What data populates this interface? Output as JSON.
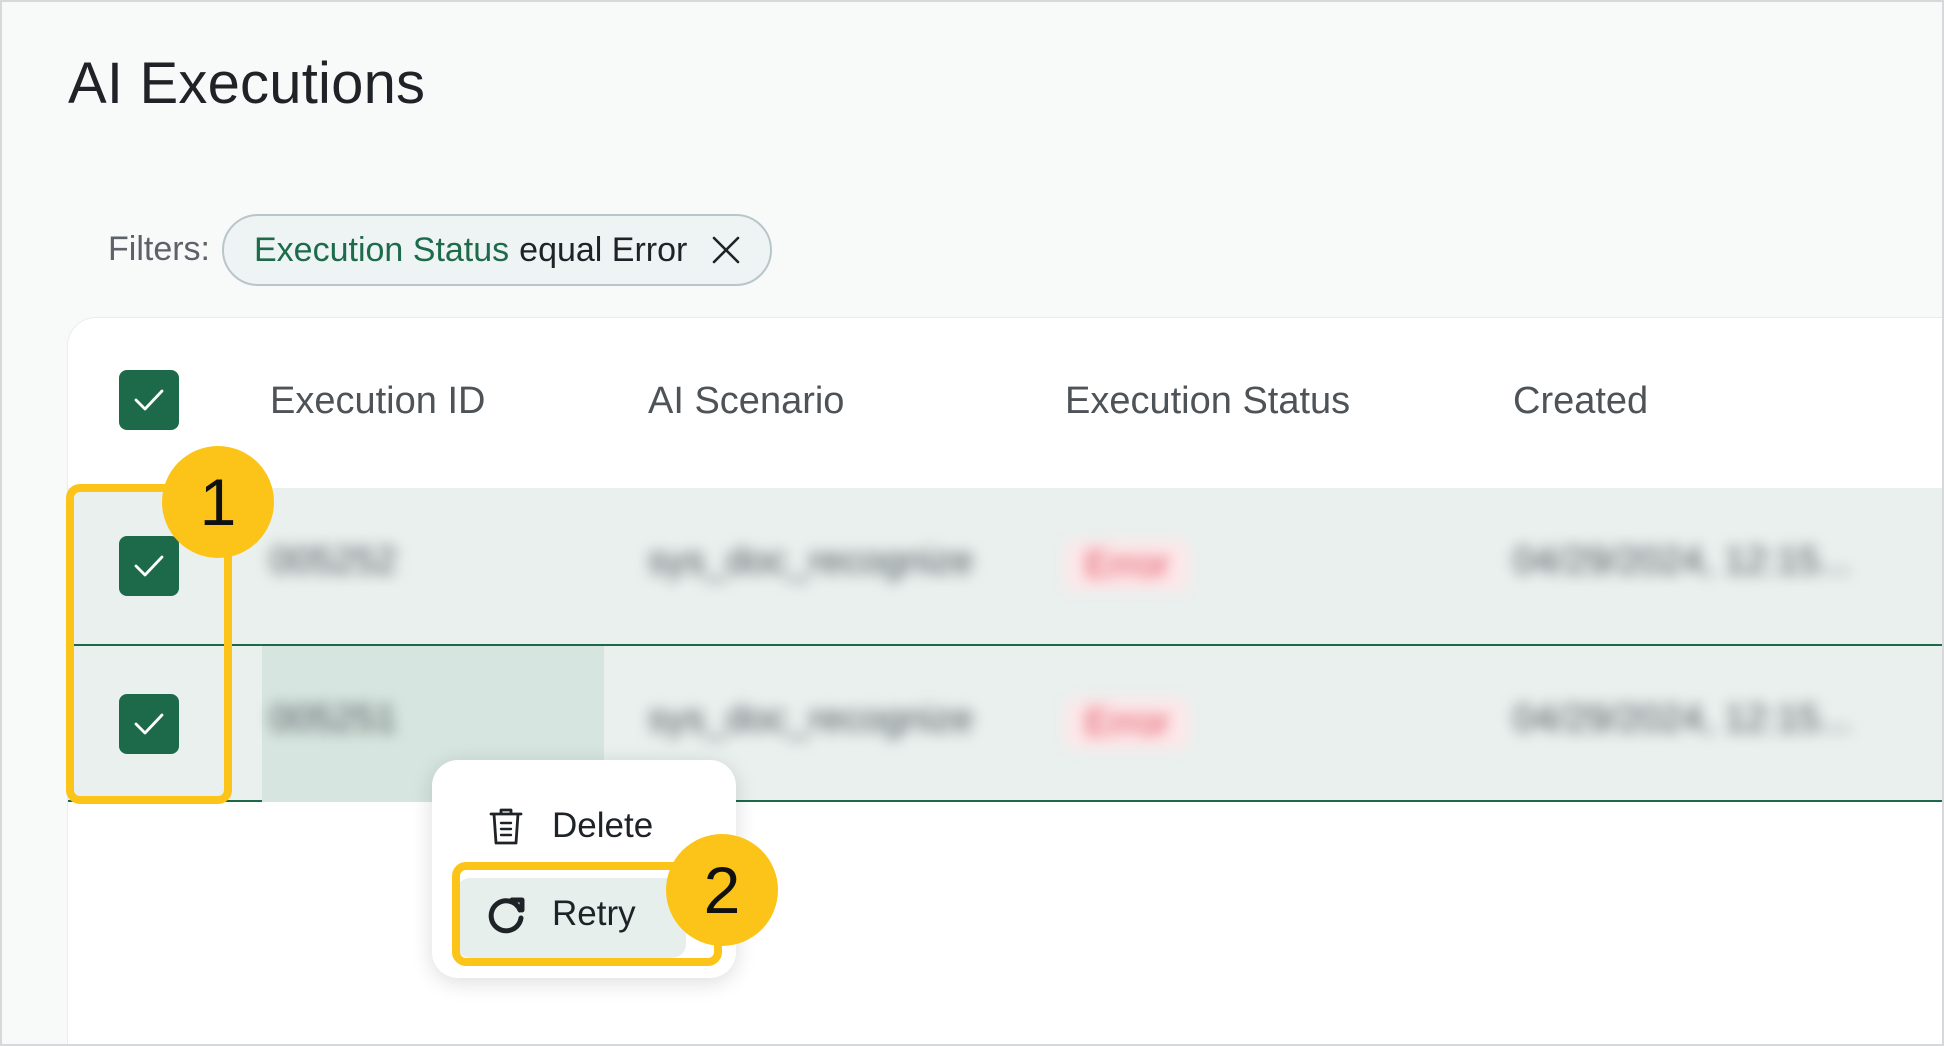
{
  "page": {
    "title": "AI Executions"
  },
  "filters": {
    "label": "Filters:",
    "chip": {
      "field": "Execution Status",
      "rest": "equal Error"
    }
  },
  "table": {
    "columns": [
      "Execution ID",
      "AI Scenario",
      "Execution Status",
      "Created"
    ],
    "rows": [
      {
        "id": "005252",
        "scenario": "sys_doc_recognize",
        "status": "Error",
        "created": "04/29/2024, 12:15..."
      },
      {
        "id": "005251",
        "scenario": "sys_doc_recognize",
        "status": "Error",
        "created": "04/29/2024, 12:15..."
      }
    ]
  },
  "context_menu": {
    "items": [
      {
        "label": "Delete",
        "icon": "trash-icon"
      },
      {
        "label": "Retry",
        "icon": "retry-icon"
      }
    ]
  },
  "annotations": {
    "step1": "1",
    "step2": "2"
  },
  "colors": {
    "accent": "#1c6a4a",
    "highlight": "#fcc419",
    "row_selected": "#e9f0ee",
    "error": "#e04c5c"
  }
}
